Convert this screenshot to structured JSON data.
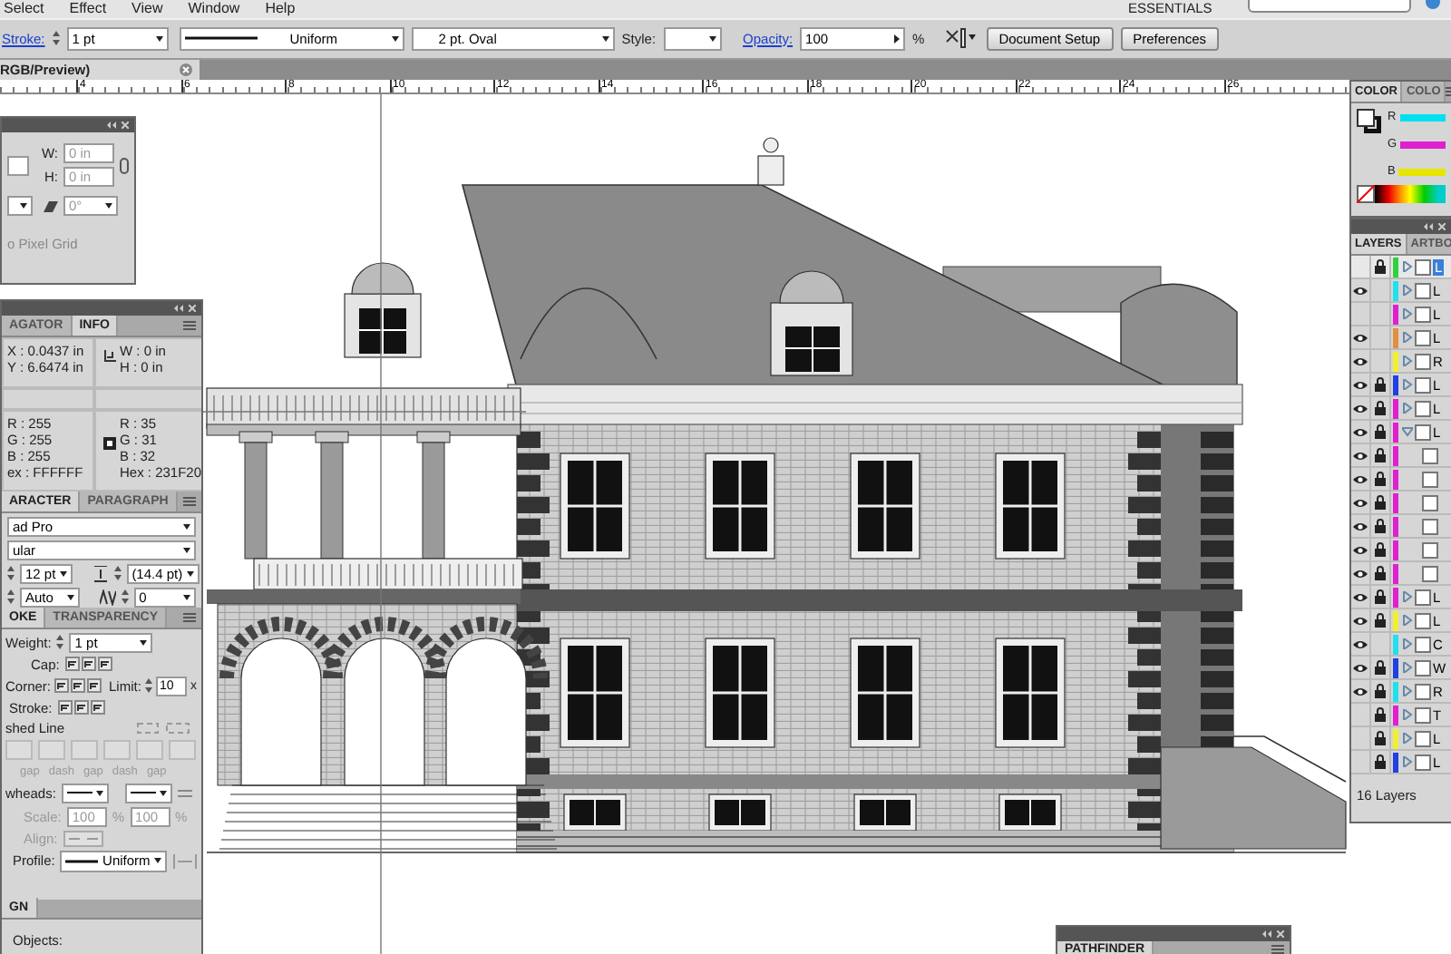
{
  "menu_bar": {
    "items": [
      "Select",
      "Effect",
      "View",
      "Window",
      "Help"
    ],
    "workspace": "ESSENTIALS"
  },
  "control_bar": {
    "stroke_label": "Stroke:",
    "stroke_weight": "1 pt",
    "profile": "Uniform",
    "brush": "2 pt. Oval",
    "style_label": "Style:",
    "opacity_label": "Opacity:",
    "opacity": "100",
    "opacity_unit": "%",
    "buttons": [
      "Document Setup",
      "Preferences"
    ]
  },
  "document_tab": {
    "title": "RGB/Preview)"
  },
  "ruler": {
    "ticks": [
      "4",
      "6",
      "8",
      "10",
      "12",
      "14",
      "16",
      "18",
      "20",
      "22",
      "24",
      "26"
    ]
  },
  "transform_panel": {
    "fields": [
      {
        "label": "W:",
        "value": "0 in"
      },
      {
        "label": "H:",
        "value": "0 in"
      }
    ],
    "shear": "0°",
    "pixel_grid": "o Pixel Grid"
  },
  "info_panel": {
    "tabs": [
      {
        "label": "AGATOR",
        "selected": false
      },
      {
        "label": "INFO",
        "selected": true
      }
    ],
    "position": [
      "X : 0.0437 in",
      "Y : 6.6474 in"
    ],
    "size": [
      "W : 0 in",
      "H : 0 in"
    ],
    "fill_values": [
      "R : 255",
      "G : 255",
      "B : 255",
      "ex : FFFFFF"
    ],
    "stroke_values": [
      "R : 35",
      "G : 31",
      "B : 32",
      "Hex : 231F20"
    ]
  },
  "character_panel": {
    "tabs": [
      {
        "label": "ARACTER",
        "selected": true
      },
      {
        "label": "PARAGRAPH",
        "selected": false
      }
    ],
    "font": "ad Pro",
    "style": "ular",
    "size": "12 pt",
    "leading": "(14.4 pt)",
    "kerning": "Auto",
    "tracking": "0"
  },
  "stroke_panel": {
    "tabs": [
      {
        "label": "OKE",
        "selected": true
      },
      {
        "label": "TRANSPARENCY",
        "selected": false
      }
    ],
    "weight_label": "Weight:",
    "weight": "1 pt",
    "cap_label": "Cap:",
    "corner_label": "Corner:",
    "limit_label": "Limit:",
    "limit": "10",
    "limit_unit": "x",
    "align_label": "Stroke:",
    "dashed_label": "shed Line",
    "dash_labels": [
      "gap",
      "dash",
      "gap",
      "dash",
      "gap"
    ],
    "arrowheads_label": "wheads:",
    "scale_label": "Scale:",
    "scale": [
      "100",
      "100"
    ],
    "scale_unit": "%",
    "align2_label": "Align:",
    "profile_label": "Profile:",
    "profile": "Uniform"
  },
  "align_panel": {
    "tab": "GN",
    "objects_label": "Objects:"
  },
  "color_panel": {
    "tabs": [
      {
        "label": "COLOR",
        "selected": true
      },
      {
        "label": "COLO",
        "selected": false
      }
    ],
    "channels": [
      {
        "label": "R",
        "color": "#00e0ee"
      },
      {
        "label": "G",
        "color": "#e020d0"
      },
      {
        "label": "B",
        "color": "#e6e600"
      }
    ]
  },
  "layers_panel": {
    "tabs": [
      {
        "label": "LAYERS",
        "selected": true
      },
      {
        "label": "ARTBO",
        "selected": false
      }
    ],
    "layers": [
      {
        "name": "L",
        "visible": false,
        "locked": true,
        "color": "#30d040",
        "selected": true,
        "expanded": false
      },
      {
        "name": "L",
        "visible": true,
        "locked": false,
        "color": "#20e0f0",
        "selected": false,
        "expanded": false
      },
      {
        "name": "L",
        "visible": false,
        "locked": false,
        "color": "#e020d0",
        "selected": false,
        "expanded": false
      },
      {
        "name": "L",
        "visible": true,
        "locked": false,
        "color": "#e09040",
        "selected": false,
        "expanded": false
      },
      {
        "name": "R",
        "visible": true,
        "locked": false,
        "color": "#f0f030",
        "selected": false,
        "expanded": false
      },
      {
        "name": "L",
        "visible": true,
        "locked": true,
        "color": "#2040e0",
        "selected": false,
        "expanded": false
      },
      {
        "name": "L",
        "visible": true,
        "locked": true,
        "color": "#e020d0",
        "selected": false,
        "expanded": false
      },
      {
        "name": "L",
        "visible": true,
        "locked": true,
        "color": "#e020d0",
        "selected": false,
        "expanded": true,
        "children": [
          {
            "visible": true,
            "locked": true,
            "color": "#e020d0"
          },
          {
            "visible": true,
            "locked": true,
            "color": "#e020d0"
          },
          {
            "visible": true,
            "locked": true,
            "color": "#e020d0"
          },
          {
            "visible": true,
            "locked": true,
            "color": "#e020d0"
          },
          {
            "visible": true,
            "locked": true,
            "color": "#e020d0"
          },
          {
            "visible": true,
            "locked": true,
            "color": "#e020d0"
          }
        ]
      },
      {
        "name": "L",
        "visible": true,
        "locked": true,
        "color": "#e020d0",
        "selected": false,
        "expanded": false
      },
      {
        "name": "L",
        "visible": true,
        "locked": true,
        "color": "#f0f030",
        "selected": false,
        "expanded": false
      },
      {
        "name": "C",
        "visible": true,
        "locked": false,
        "color": "#20e0f0",
        "selected": false,
        "expanded": false
      },
      {
        "name": "W",
        "visible": true,
        "locked": true,
        "color": "#2040e0",
        "selected": false,
        "expanded": false
      },
      {
        "name": "R",
        "visible": true,
        "locked": true,
        "color": "#20e0f0",
        "selected": false,
        "expanded": false
      },
      {
        "name": "T",
        "visible": false,
        "locked": true,
        "color": "#e020d0",
        "selected": false,
        "expanded": false
      },
      {
        "name": "L",
        "visible": false,
        "locked": true,
        "color": "#f0f030",
        "selected": false,
        "expanded": false
      },
      {
        "name": "L",
        "visible": false,
        "locked": true,
        "color": "#2040e0",
        "selected": false,
        "expanded": false
      }
    ],
    "count": "16 Layers"
  },
  "pathfinder_panel": {
    "tab": "PATHFINDER"
  }
}
